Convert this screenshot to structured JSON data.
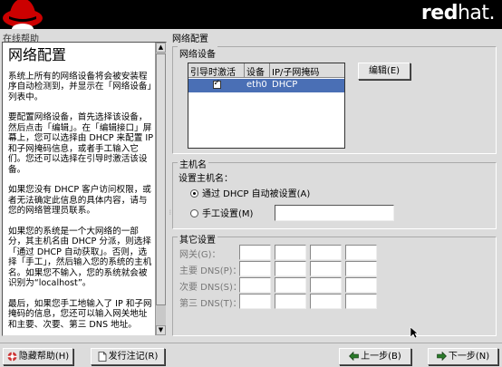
{
  "header": {
    "brand_main": "red",
    "brand_dot": "hat.",
    "logo_icon": "shadowman-icon"
  },
  "help": {
    "panel_title": "在线帮助",
    "heading": "网络配置",
    "paragraphs": [
      "系统上所有的网络设备将会被安装程序自动检测到，并显示在「网络设备」列表中。",
      "要配置网络设备，首先选择该设备，然后点击「编辑」。在「编辑接口」屏幕上，您可以选择由 DHCP 来配置 IP 和子网掩码信息，或者手工输入它们。您还可以选择在引导时激活该设备。",
      "如果您没有 DHCP 客户访问权限，或者无法确定此信息的具体内容，请与您的网络管理员联系。",
      "如果您的系统是一个大网络的一部分，其主机名由 DHCP 分派，则选择「通过 DHCP 自动获取」。否则，选择「手工」，然后输入您的系统的主机名。如果您不输入，您的系统就会被识别为“localhost”。",
      "最后，如果您手工地输入了 IP 和子网掩码的信息，您还可以输入网关地址和主要、次要、第三 DNS 地址。"
    ]
  },
  "network": {
    "section_title": "网络配置",
    "devices_title": "网络设备",
    "columns": [
      "引导时激活",
      "设备",
      "IP/子网掩码"
    ],
    "rows": [
      {
        "active": true,
        "device": "eth0",
        "ip": "DHCP"
      }
    ],
    "edit_button": "编辑(E)"
  },
  "hostname": {
    "title": "主机名",
    "prompt": "设置主机名：",
    "dhcp_option": "通过 DHCP 自动被设置(A)",
    "manual_option": "手工设置(M)",
    "selected": "dhcp",
    "manual_value": ""
  },
  "other": {
    "title": "其它设置",
    "gateway_label": "网关(G)：",
    "dns1_label": "主要 DNS(P)：",
    "dns2_label": "次要 DNS(S)：",
    "dns3_label": "第三 DNS(T)："
  },
  "footer": {
    "hide_help": "隐藏帮助(H)",
    "release_notes": "发行注记(R)",
    "back": "上一步(B)",
    "next": "下一步(N)"
  },
  "colors": {
    "selection": "#4a6fb5",
    "brand_red": "#cc0000",
    "window_bg": "#dcdcdc"
  }
}
